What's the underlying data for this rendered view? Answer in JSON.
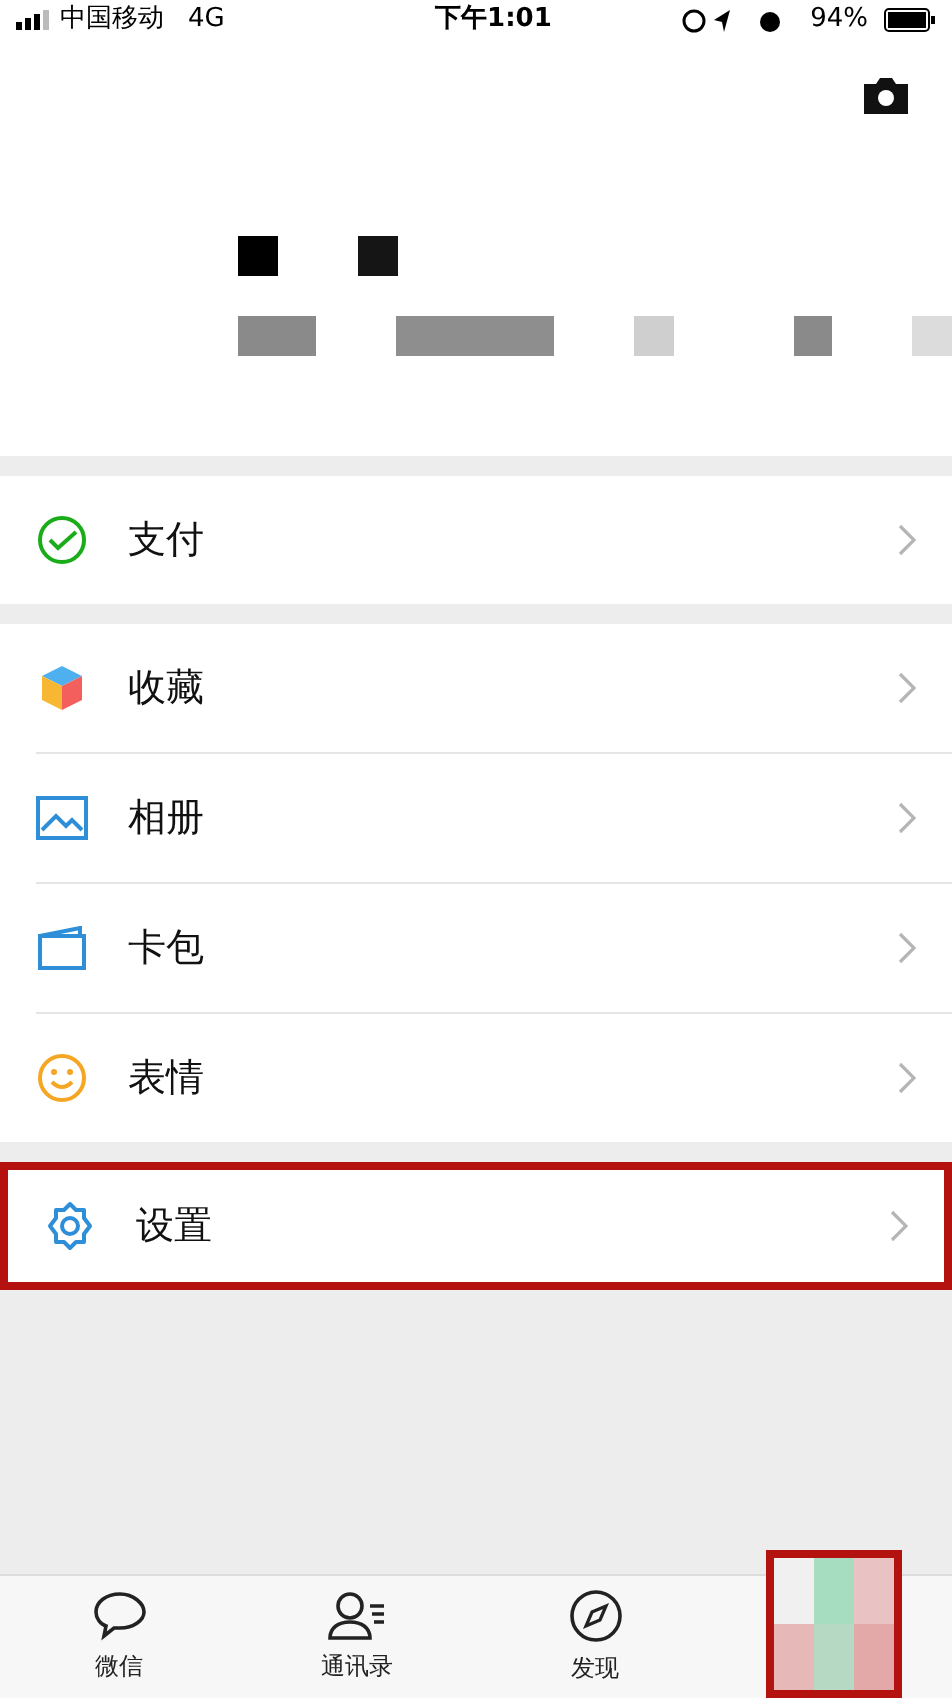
{
  "status_bar": {
    "carrier": "中国移动",
    "network": "4G",
    "time": "下午1:01",
    "battery": "94%"
  },
  "menu_groups": [
    [
      {
        "label": "支付",
        "highlighted": false
      }
    ],
    [
      {
        "label": "收藏",
        "highlighted": false
      },
      {
        "label": "相册",
        "highlighted": false
      },
      {
        "label": "卡包",
        "highlighted": false
      },
      {
        "label": "表情",
        "highlighted": false
      }
    ],
    [
      {
        "label": "设置",
        "highlighted": true
      }
    ]
  ],
  "tab_bar": [
    {
      "label": "微信",
      "redacted": false,
      "highlighted": false
    },
    {
      "label": "通讯录",
      "redacted": false,
      "highlighted": false
    },
    {
      "label": "发现",
      "redacted": false,
      "highlighted": false
    },
    {
      "redacted": true,
      "highlighted": true
    }
  ]
}
